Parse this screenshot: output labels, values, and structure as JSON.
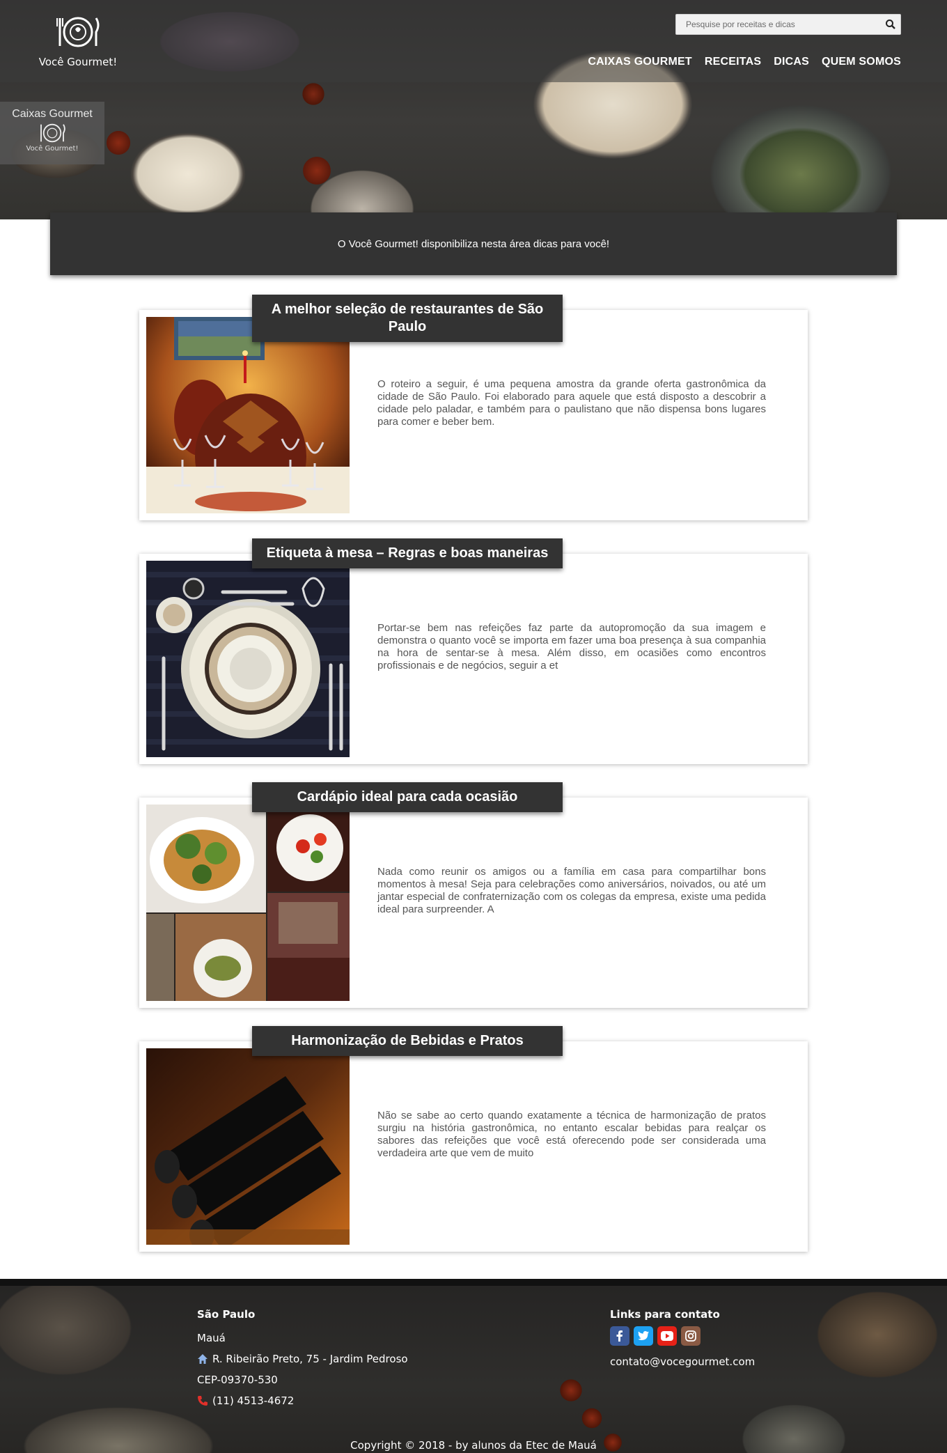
{
  "header": {
    "brand": "Você Gourmet!",
    "search_placeholder": "Pesquise por receitas e dicas",
    "nav": [
      "CAIXAS GOURMET",
      "RECEITAS",
      "DICAS",
      "QUEM SOMOS"
    ],
    "badge_title": "Caixas Gourmet",
    "badge_sub": "Você Gourmet!"
  },
  "intro": "O Você Gourmet! disponibiliza nesta área dicas para você!",
  "cards": [
    {
      "title": "A melhor seleção de restaurantes de São Paulo",
      "text": "O roteiro a seguir, é uma pequena amostra da grande oferta gastronômica da cidade de São Paulo. Foi elaborado para aquele que está disposto a descobrir a cidade pelo paladar, e também para o paulistano que não dispensa bons lugares para comer e beber bem."
    },
    {
      "title": "Etiqueta à mesa – Regras e boas maneiras",
      "text": "Portar-se bem nas refeições faz parte da autopromoção da sua imagem e demonstra o quanto você se importa em fazer uma boa presença à sua companhia na hora de sentar-se à mesa. Além disso, em ocasiões como encontros profissionais e de negócios, seguir a et"
    },
    {
      "title": "Cardápio ideal para cada ocasião",
      "text": "Nada como reunir os amigos ou a família em casa para compartilhar bons momentos à mesa! Seja para celebrações como aniversários, noivados, ou até um jantar especial de confraternização com os colegas da empresa, existe uma pedida ideal para surpreender. A"
    },
    {
      "title": "Harmonização de Bebidas e Pratos",
      "text": "Não se sabe ao certo quando exatamente a técnica de harmonização de pratos surgiu na história gastronômica, no entanto escalar bebidas para realçar os sabores das refeições que você está oferecendo pode ser considerada uma verdadeira arte que vem de muito"
    }
  ],
  "footer": {
    "city": "São Paulo",
    "district": "Mauá",
    "address": "R. Ribeirão Preto, 75 - Jardim Pedroso",
    "cep": "CEP-09370-530",
    "phone": "(11) 4513-4672",
    "links_title": "Links para contato",
    "socials": [
      "facebook-icon",
      "twitter-icon",
      "youtube-icon",
      "instagram-icon"
    ],
    "email": "contato@vocegourmet.com",
    "copyright": "Copyright © 2018 - by alunos da Etec de Mauá"
  },
  "colors": {
    "dark_panel": "#333333",
    "facebook": "#3b5998",
    "twitter": "#1da1f2",
    "youtube": "#e62117",
    "instagram": "#8a5a44"
  }
}
